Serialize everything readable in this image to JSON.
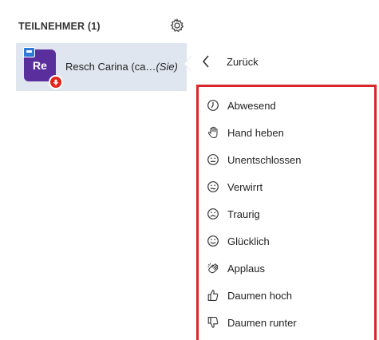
{
  "panel": {
    "title": "TEILNEHMER (1)",
    "settings_icon": "gear-icon"
  },
  "participant": {
    "initials": "Re",
    "avatar_color": "#5b2e9e",
    "name": "Resch Carina (ca…",
    "self_tag": "(Sie)"
  },
  "menu": {
    "back_label": "Zurück",
    "highlight_color": "#d9262b",
    "statuses": [
      {
        "label": "Abwesend",
        "icon": "clock-icon"
      },
      {
        "label": "Hand heben",
        "icon": "hand-icon"
      },
      {
        "label": "Unentschlossen",
        "icon": "neutral-face-icon"
      },
      {
        "label": "Verwirrt",
        "icon": "confused-face-icon"
      },
      {
        "label": "Traurig",
        "icon": "sad-face-icon"
      },
      {
        "label": "Glücklich",
        "icon": "happy-face-icon"
      },
      {
        "label": "Applaus",
        "icon": "applause-icon"
      },
      {
        "label": "Daumen hoch",
        "icon": "thumbs-up-icon"
      },
      {
        "label": "Daumen runter",
        "icon": "thumbs-down-icon"
      }
    ]
  }
}
